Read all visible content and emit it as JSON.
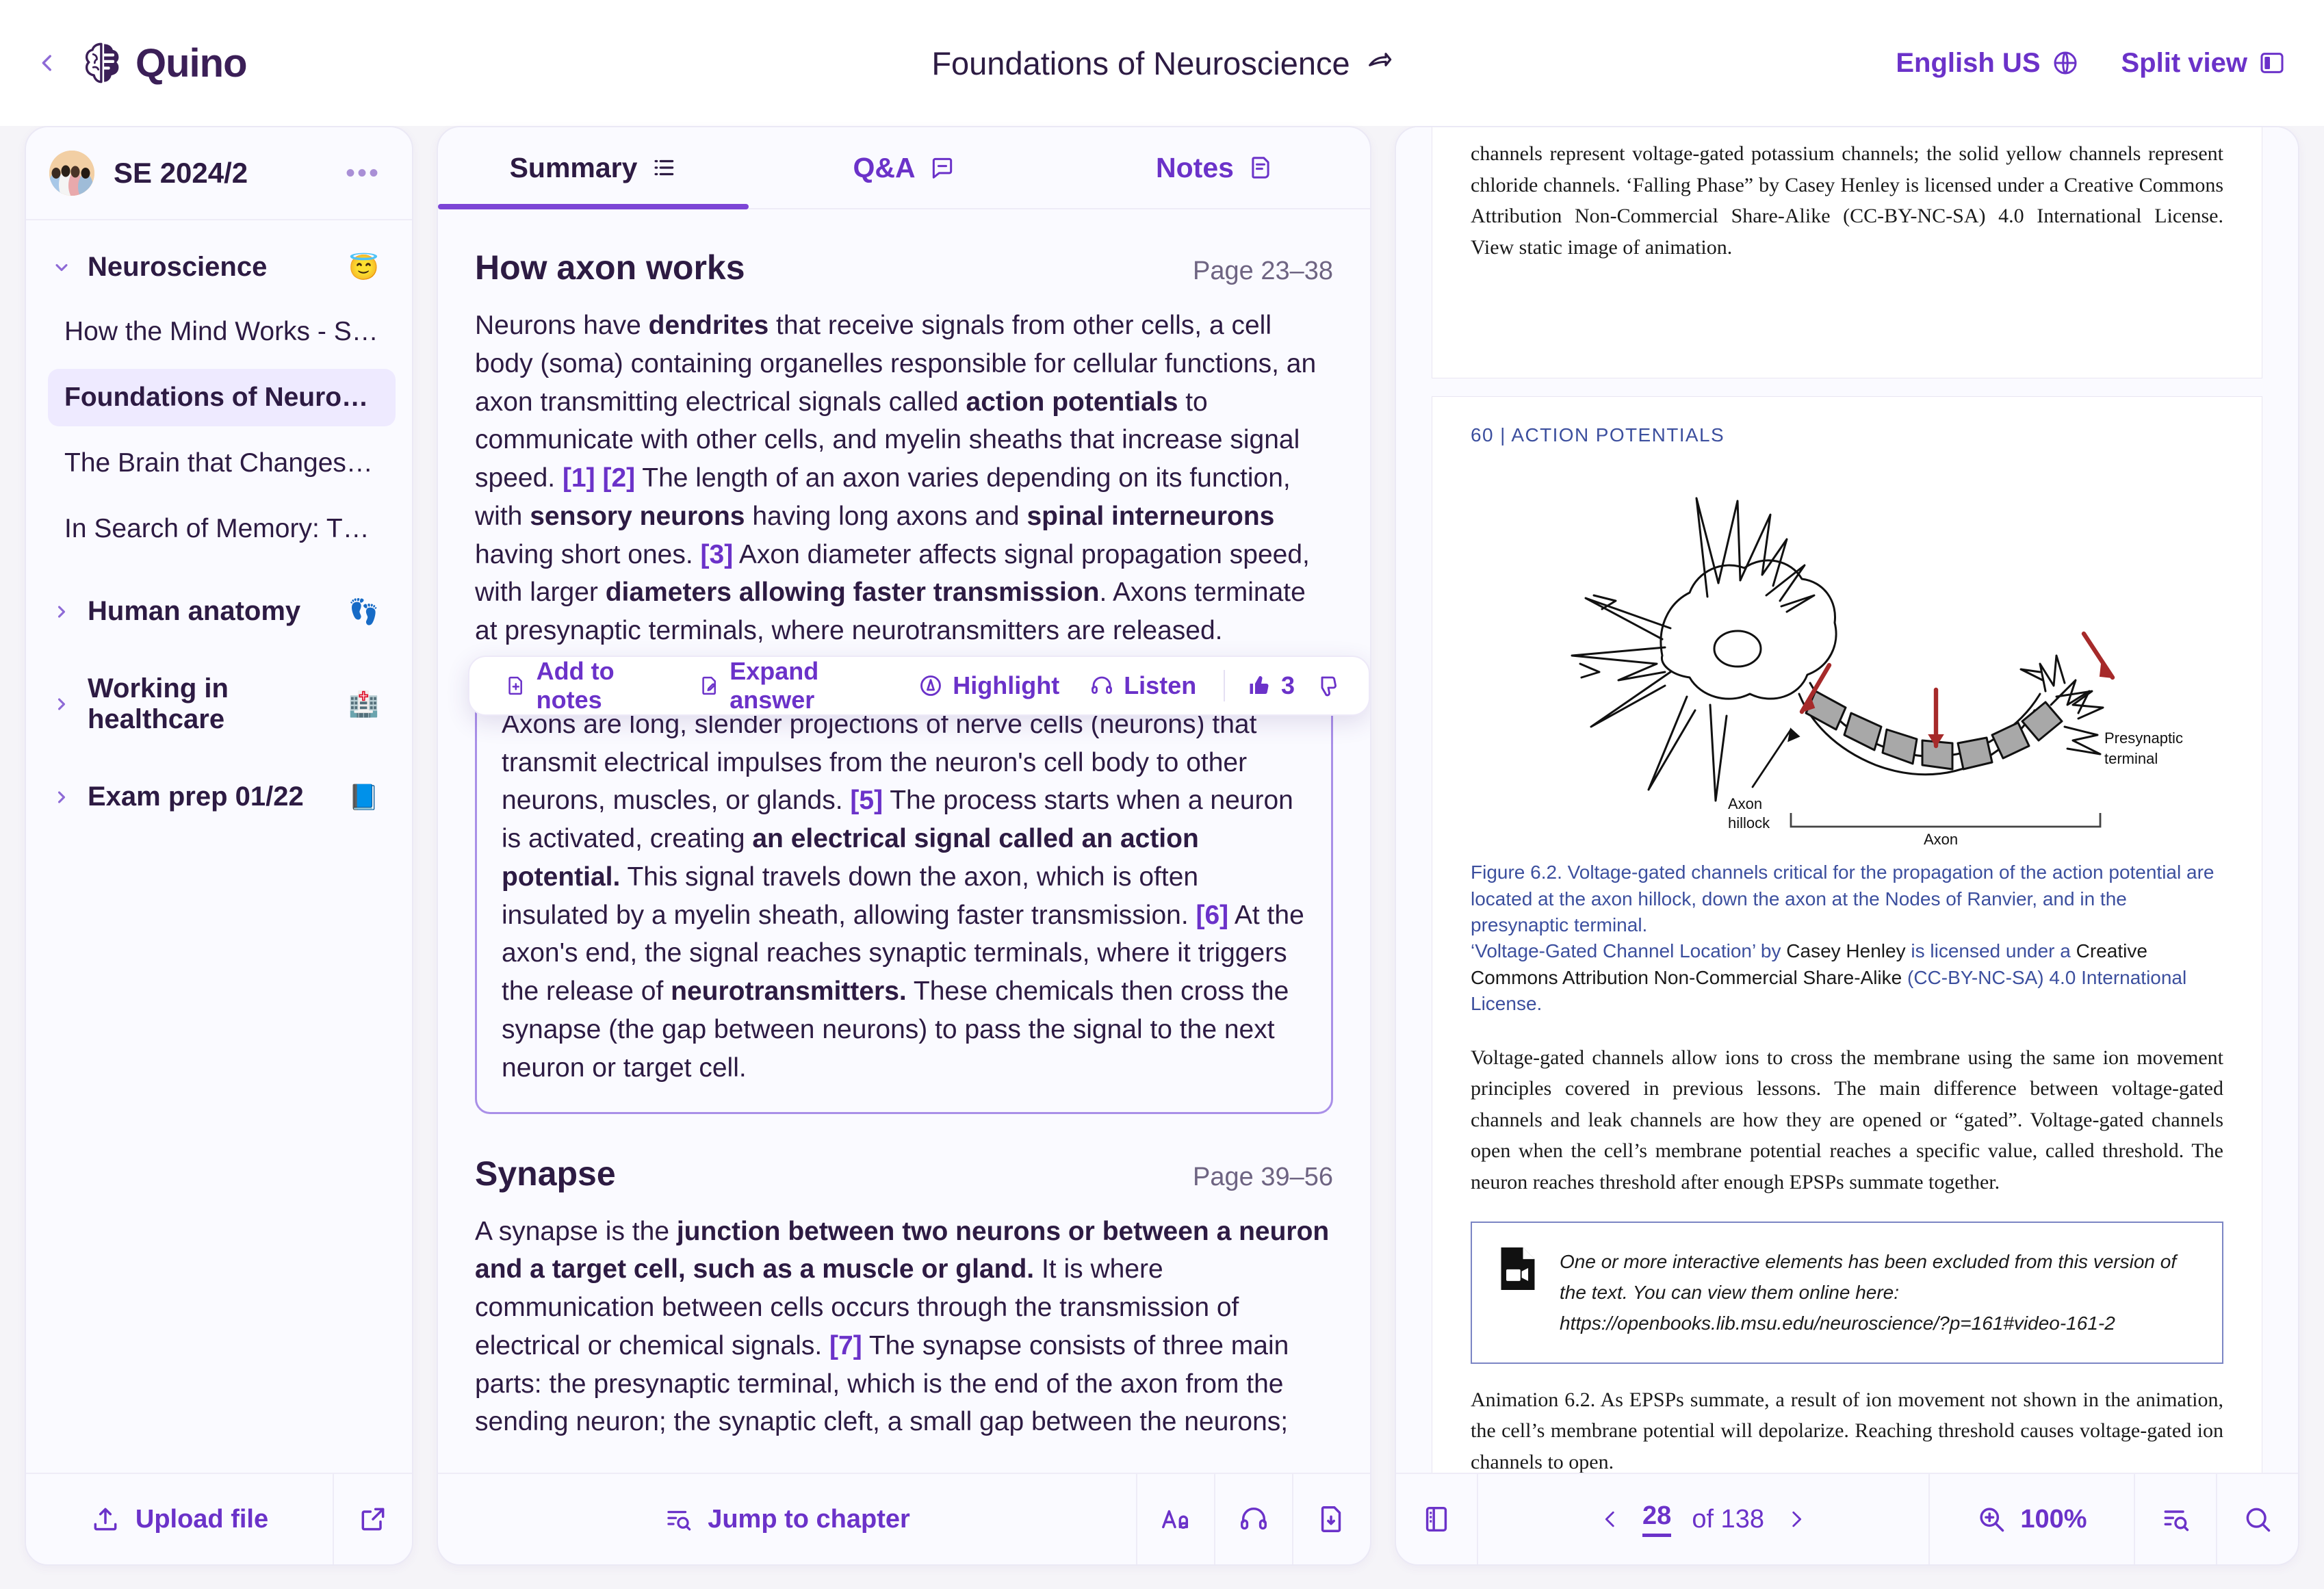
{
  "header": {
    "back_icon": "chevron-left-icon",
    "brand": "Quino",
    "doc_title": "Foundations of Neuroscience",
    "share_icon": "share-icon",
    "language": "English US",
    "globe_icon": "globe-icon",
    "split_view": "Split view",
    "split_view_icon": "split-view-icon"
  },
  "sidebar": {
    "workspace": "SE 2024/2",
    "menu_icon": "ellipsis-icon",
    "groups": [
      {
        "name": "Neuroscience",
        "expanded": true,
        "emoji": "😇",
        "emoji_name": "smiling-face-with-halo-emoji",
        "items": [
          {
            "label": "How the Mind Works - Steve…",
            "active": false
          },
          {
            "label": "Foundations of Neuroscience",
            "active": true
          },
          {
            "label": "The Brain that Changes Itself",
            "active": false
          },
          {
            "label": "In Search of Memory: The Em…",
            "active": false
          }
        ]
      },
      {
        "name": "Human anatomy",
        "expanded": false,
        "emoji": "👣",
        "emoji_name": "footprints-emoji",
        "items": []
      },
      {
        "name": "Working in healthcare",
        "expanded": false,
        "emoji": "🏥",
        "emoji_name": "hospital-emoji",
        "items": []
      },
      {
        "name": "Exam prep 01/22",
        "expanded": false,
        "emoji": "📘",
        "emoji_name": "book-emoji",
        "items": []
      }
    ],
    "upload_label": "Upload file",
    "upload_icon": "upload-icon",
    "external_icon": "external-link-icon"
  },
  "center": {
    "tabs": [
      {
        "label": "Summary",
        "icon": "list-icon",
        "active": true
      },
      {
        "label": "Q&A",
        "icon": "chat-icon",
        "active": false
      },
      {
        "label": "Notes",
        "icon": "note-icon",
        "active": false
      }
    ],
    "sections": [
      {
        "title": "How axon works",
        "pages": "Page 23–38",
        "paragraph_html": "Neurons have <b>dendrites</b> that receive signals from other cells, a cell body (soma) containing organelles responsible for cellular functions, an axon transmitting electrical signals called <b>action potentials</b> to communicate with other cells, and myelin sheaths that increase signal speed. <span class=\"ref\">[1]</span> <span class=\"ref\">[2]</span> The length of an axon varies depending on its function, with <b>sensory neurons</b> having long axons and <b>spinal interneurons</b> having short ones. <span class=\"ref\">[3]</span> Axon diameter affects signal propagation speed, with larger <b>diameters allowing faster transmission</b>. Axons terminate at presynaptic terminals, where neurotransmitters are released."
      },
      {
        "title": "Synapse",
        "pages": "Page 39–56",
        "paragraph_html": "A synapse is the <b>junction between two neurons or between a neuron and a target cell, such as a muscle or gland.</b> It is where communication between cells occurs through the transmission of electrical or chemical signals. <span class=\"ref\">[7]</span> The synapse consists of three main parts: the presynaptic terminal, which is the end of the axon from the sending neuron; the synaptic cleft, a small gap between the neurons;"
      }
    ],
    "answer_box_html": "Axons are long, slender projections of nerve cells (neurons) that transmit electrical impulses from the neuron's cell body to other neurons, muscles, or glands. <span class=\"ref\">[5]</span> The process starts when a neuron is activated, creating <b>an electrical signal called an action potential.</b> This signal travels down the axon, which is often insulated by a myelin sheath, allowing faster transmission. <span class=\"ref\">[6]</span> At the axon's end, the signal reaches synaptic terminals, where it triggers the release of <b>neurotransmitters.</b> These chemicals then cross the synapse (the gap between neurons) to pass the signal to the next neuron or target cell.",
    "toolbar": {
      "add_to_notes": "Add to notes",
      "add_to_notes_icon": "document-plus-icon",
      "expand_answer": "Expand answer",
      "expand_answer_icon": "document-pen-icon",
      "highlight": "Highlight",
      "highlight_icon": "highlight-pen-icon",
      "listen": "Listen",
      "listen_icon": "headphones-icon",
      "thumbs_up_icon": "thumbs-up-icon",
      "thumbs_up_count": "3",
      "thumbs_down_icon": "thumbs-down-icon"
    },
    "footer": {
      "jump_label": "Jump to chapter",
      "jump_icon": "jump-to-chapter-icon",
      "font_icon": "font-size-icon",
      "audio_icon": "headphones-icon",
      "download_icon": "document-download-icon"
    }
  },
  "pdf": {
    "top_paragraph": "channels represent voltage-gated potassium channels; the solid yellow channels represent chloride channels. ‘Falling Phase” by Casey Henley is licensed under a Creative Commons Attribution Non-Commercial Share-Alike (CC-BY-NC-SA) 4.0 International License. View static image of animation.",
    "running_head": "60  |  ACTION POTENTIALS",
    "figure": {
      "label_hillock": "Axon hillock",
      "label_axon": "Axon",
      "label_presynaptic": "Presynaptic terminal"
    },
    "caption_line1": "Figure 6.2. Voltage-gated channels critical for the propagation of the action potential are located at the axon hillock, down the axon at the Nodes of Ranvier, and in the presynaptic terminal.",
    "caption_line2_a": "‘Voltage-Gated Channel Location’ by ",
    "caption_line2_b": "Casey Henley",
    "caption_line2_c": " is licensed under a ",
    "caption_line2_d": "Creative Commons Attribution Non-Commercial Share-Alike",
    "caption_line2_e": " (CC-BY-NC-SA) 4.0 International License.",
    "body_paragraph": "Voltage-gated channels allow ions to cross the membrane using the same ion movement principles covered in previous lessons. The main difference between voltage-gated channels and leak channels are how they are opened or “gated”. Voltage-gated channels open when the cell’s membrane potential reaches a specific value, called threshold. The neuron reaches threshold after enough EPSPs summate together.",
    "note_icon": "video-file-icon",
    "note_text": "One or more interactive elements has been excluded from this version of the text. You can view them online here: https://openbooks.lib.msu.edu/neuroscience/?p=161#video-161-2",
    "animation_paragraph": "Animation 6.2. As EPSPs summate, a result of ion movement not shown in the animation, the cell’s membrane potential will depolarize. Reaching threshold causes voltage-gated ion channels to open.",
    "footer": {
      "sidebar_icon": "pdf-sidebar-icon",
      "prev_icon": "chevron-left-icon",
      "page_current": "28",
      "page_of": "of 138",
      "next_icon": "chevron-right-icon",
      "zoom_icon": "zoom-in-icon",
      "zoom_level": "100%",
      "outline_icon": "jump-to-chapter-icon",
      "search_icon": "search-icon"
    }
  },
  "colors": {
    "accent": "#6b32c9",
    "accent_light": "#7c45d6",
    "ink": "#2d1b43",
    "panel_bg": "#fafaff",
    "page_bg": "#f5f4f8",
    "pdf_blue": "#3c4f9e",
    "arrow_red": "#a62a2a"
  }
}
